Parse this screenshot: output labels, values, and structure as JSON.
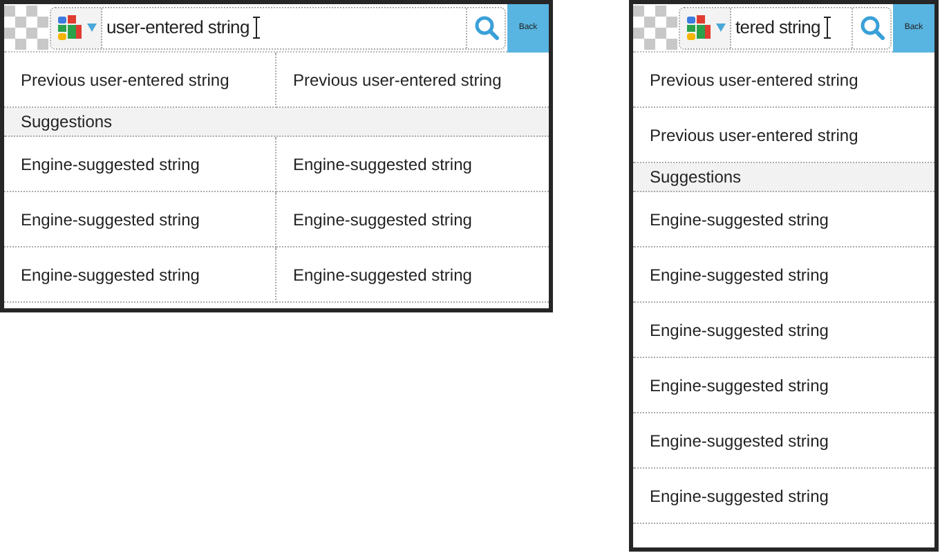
{
  "screens": [
    {
      "kind": "landscape",
      "search": {
        "value": "user-entered string"
      },
      "back_button": "Back",
      "history": [
        "Previous user-entered string",
        "Previous user-entered string"
      ],
      "section_header": "Suggestions",
      "suggestions": [
        "Engine-suggested string",
        "Engine-suggested string",
        "Engine-suggested string",
        "Engine-suggested string",
        "Engine-suggested string",
        "Engine-suggested string"
      ]
    },
    {
      "kind": "portrait",
      "search": {
        "value": "tered string"
      },
      "back_button": "Back",
      "history": [
        "Previous user-entered string",
        "Previous user-entered string"
      ],
      "section_header": "Suggestions",
      "suggestions": [
        "Engine-suggested string",
        "Engine-suggested string",
        "Engine-suggested string",
        "Engine-suggested string",
        "Engine-suggested string",
        "Engine-suggested string"
      ]
    }
  ]
}
